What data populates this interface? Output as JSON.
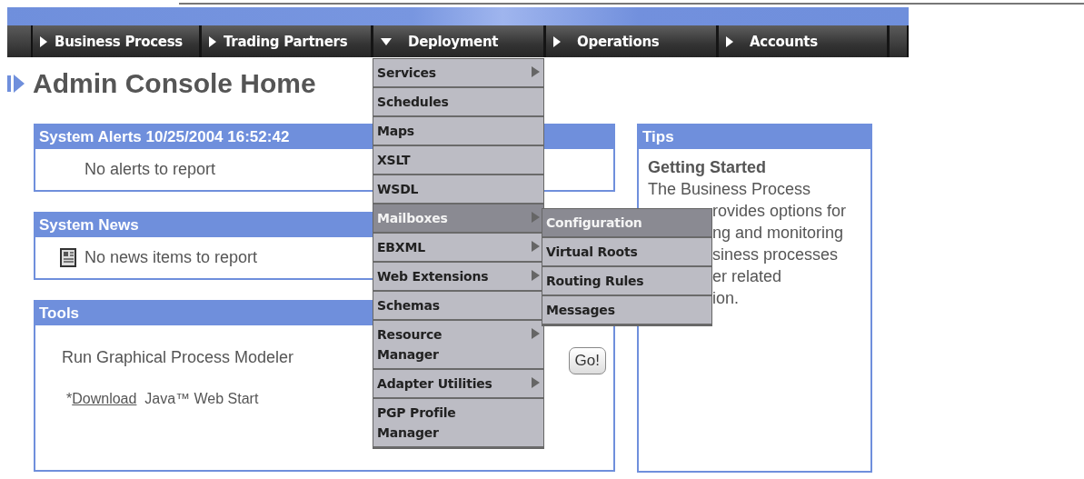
{
  "nav": {
    "items": [
      {
        "label": "Business Process",
        "expanded": false
      },
      {
        "label": "Trading Partners",
        "expanded": false
      },
      {
        "label": "Deployment",
        "expanded": true
      },
      {
        "label": "Operations",
        "expanded": false
      },
      {
        "label": "Accounts",
        "expanded": false
      }
    ]
  },
  "page_title": "Admin Console Home",
  "deployment_menu": {
    "items": [
      {
        "label": "Services",
        "submenu": true,
        "selected": false
      },
      {
        "label": "Schedules",
        "submenu": false,
        "selected": false
      },
      {
        "label": "Maps",
        "submenu": false,
        "selected": false
      },
      {
        "label": "XSLT",
        "submenu": false,
        "selected": false
      },
      {
        "label": "WSDL",
        "submenu": false,
        "selected": false
      },
      {
        "label": "Mailboxes",
        "submenu": true,
        "selected": true
      },
      {
        "label": "EBXML",
        "submenu": true,
        "selected": false
      },
      {
        "label": "Web Extensions",
        "submenu": true,
        "selected": false
      },
      {
        "label": "Schemas",
        "submenu": false,
        "selected": false
      },
      {
        "label": "Resource\nManager",
        "submenu": true,
        "selected": false
      },
      {
        "label": "Adapter Utilities",
        "submenu": true,
        "selected": false
      },
      {
        "label": "PGP Profile\nManager",
        "submenu": false,
        "selected": false
      }
    ]
  },
  "mailboxes_submenu": {
    "items": [
      {
        "label": "Configuration",
        "selected": true
      },
      {
        "label": "Virtual Roots",
        "selected": false
      },
      {
        "label": "Routing Rules",
        "selected": false
      },
      {
        "label": "Messages",
        "selected": false
      }
    ]
  },
  "panels": {
    "alerts": {
      "title": "System Alerts 10/25/2004 16:52:42",
      "message": "No alerts to report"
    },
    "news": {
      "title": "System News",
      "message": "No news items to report"
    },
    "tools": {
      "title": "Tools",
      "tool_name": "Run Graphical Process Modeler",
      "button": "Go!",
      "note_prefix": "*",
      "link": "Download",
      "note_suffix": "Java™ Web Start"
    }
  },
  "tips": {
    "title": "Tips",
    "heading": "Getting Started",
    "lines": [
      {
        "text": "The Business Process",
        "covered": false
      },
      {
        "text": "rovides options for",
        "covered": true
      },
      {
        "text": "ng and monitoring",
        "covered": true
      },
      {
        "text": "siness processes",
        "covered": true
      },
      {
        "text": "er related",
        "covered": true
      },
      {
        "text": "ion.",
        "covered": true
      }
    ]
  }
}
